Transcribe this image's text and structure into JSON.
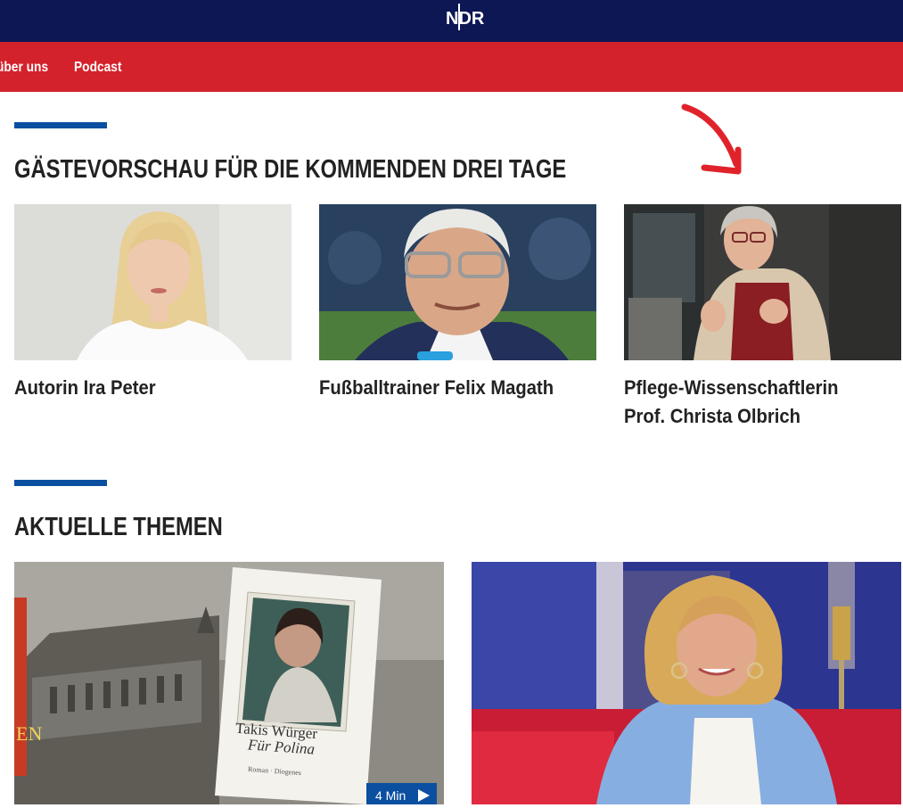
{
  "header": {
    "logo_text": "NDR"
  },
  "nav": {
    "items": [
      {
        "label": "über uns"
      },
      {
        "label": "Podcast"
      }
    ]
  },
  "guests_section": {
    "title": "GÄSTEVORSCHAU FÜR DIE KOMMENDEN DREI TAGE",
    "cards": [
      {
        "caption_lines": [
          "Autorin Ira Peter"
        ]
      },
      {
        "caption_lines": [
          "Fußballtrainer Felix Magath"
        ]
      },
      {
        "caption_lines": [
          "Pflege-Wissenschaftlerin",
          "Prof. Christa Olbrich"
        ]
      }
    ]
  },
  "topics_section": {
    "title": "AKTUELLE THEMEN",
    "cards": [
      {
        "book_author": "Takis Würger",
        "book_title": "Für Polina",
        "book_imprint": "Roman · Diogenes",
        "duration": "4 Min"
      },
      {}
    ]
  },
  "colors": {
    "topbar": "#0c1754",
    "navbar": "#d4222c",
    "accent": "#0b4fa0",
    "annotation": "#e0232b"
  }
}
